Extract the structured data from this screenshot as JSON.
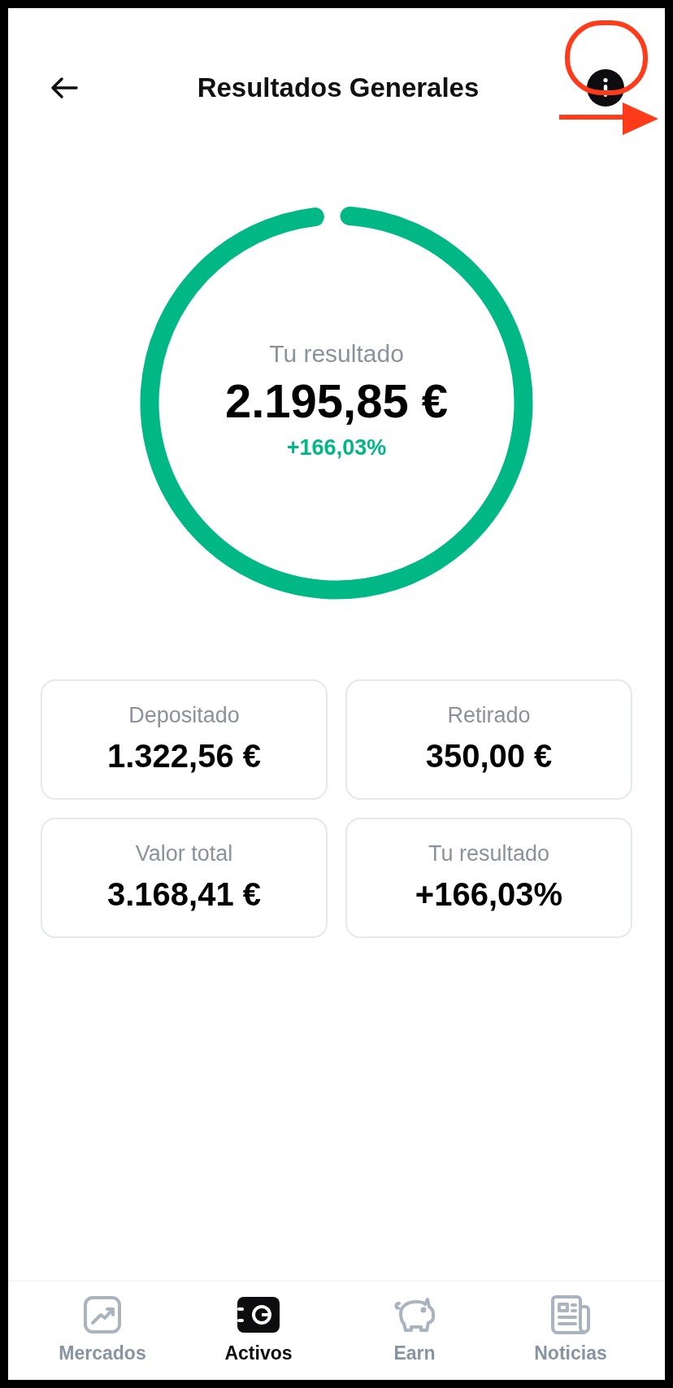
{
  "header": {
    "title": "Resultados Generales"
  },
  "gauge": {
    "label": "Tu resultado",
    "amount": "2.195,85 €",
    "change": "+166,03%"
  },
  "stats": [
    {
      "label": "Depositado",
      "value": "1.322,56 €"
    },
    {
      "label": "Retirado",
      "value": "350,00 €"
    },
    {
      "label": "Valor total",
      "value": "3.168,41 €"
    },
    {
      "label": "Tu resultado",
      "value": "+166,03%"
    }
  ],
  "nav": [
    {
      "kind": "chart",
      "label": "Mercados",
      "selected": false
    },
    {
      "kind": "wallet",
      "label": "Activos",
      "selected": true
    },
    {
      "kind": "piggy",
      "label": "Earn",
      "selected": false
    },
    {
      "kind": "news",
      "label": "Noticias",
      "selected": false
    }
  ]
}
